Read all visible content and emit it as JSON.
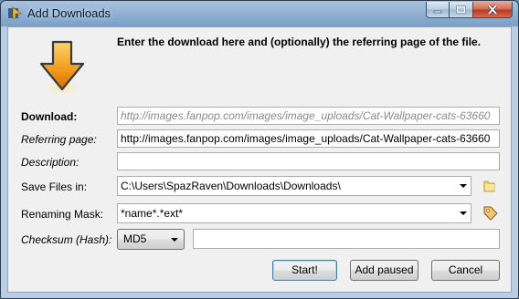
{
  "window": {
    "title": "Add Downloads"
  },
  "instructions": "Enter the download here and (optionally) the referring page of the file.",
  "fields": {
    "download": {
      "label": "Download:",
      "placeholder": "http://images.fanpop.com/images/image_uploads/Cat-Wallpaper-cats-63660"
    },
    "referrer": {
      "label": "Referring page:",
      "value": "http://images.fanpop.com/images/image_uploads/Cat-Wallpaper-cats-63660"
    },
    "description": {
      "label": "Description:",
      "value": ""
    },
    "save_files": {
      "label": "Save Files in:",
      "value": "C:\\Users\\SpazRaven\\Downloads\\Downloads\\"
    },
    "renaming": {
      "label": "Renaming Mask:",
      "value": "*name*.*ext*"
    },
    "checksum": {
      "label": "Checksum (Hash):",
      "algorithm": "MD5",
      "value": ""
    }
  },
  "buttons": {
    "start": "Start!",
    "add_paused": "Add paused",
    "cancel": "Cancel"
  },
  "icons": {
    "window": "download-window-icon",
    "arrow": "download-arrow-icon",
    "folder": "folder-icon",
    "tag": "tag-icon"
  },
  "colors": {
    "arrow_fill": "#f29a1a",
    "folder": "#f3d36a",
    "close_button": "#c8452b"
  }
}
